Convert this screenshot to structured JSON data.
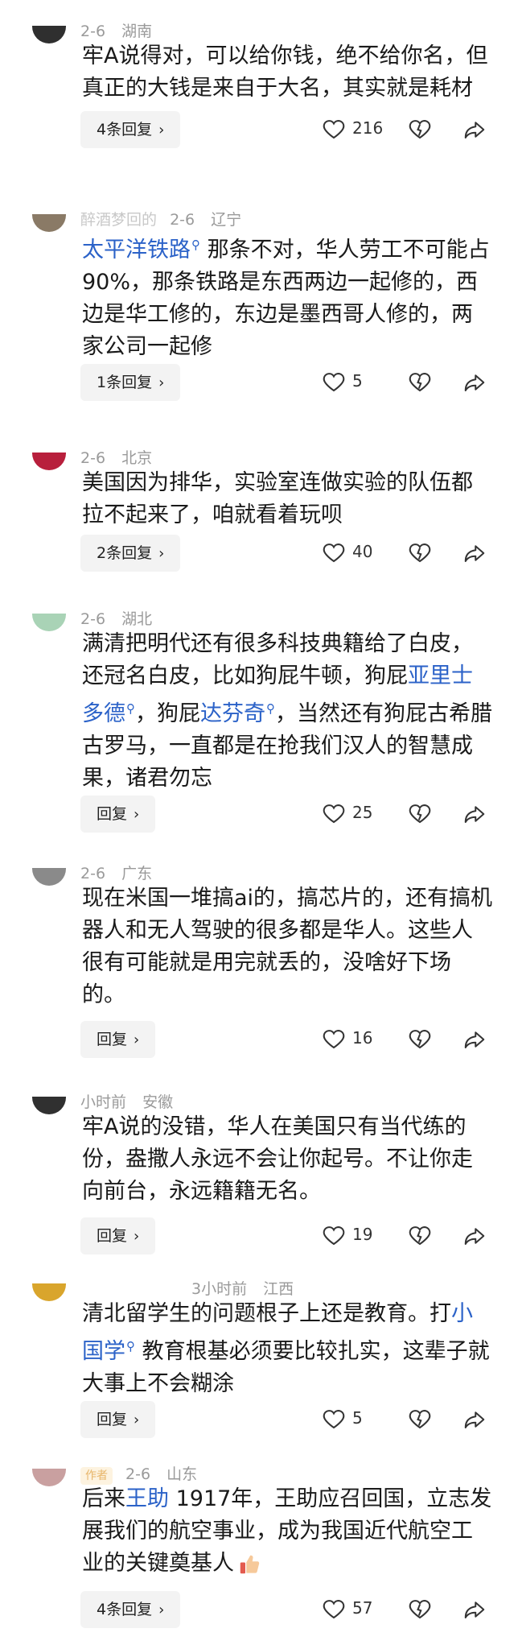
{
  "comments": [
    {
      "meta": {
        "name": "",
        "time": "2-6",
        "location": "湖南"
      },
      "text": "牢A说得对，可以给你钱，绝不给你名，但真正的大钱是来自于大名，其实就是耗材",
      "reply_label": "4条回复",
      "likes": "216"
    },
    {
      "meta": {
        "name": "醉酒梦回的",
        "time": "2-6",
        "location": "辽宁"
      },
      "link": "太平洋铁路",
      "text": "那条不对，华人劳工不可能占90%，那条铁路是东西两边一起修的，西边是华工修的，东边是墨西哥人修的，两家公司一起修",
      "reply_label": "1条回复",
      "likes": "5"
    },
    {
      "meta": {
        "name": "",
        "time": "2-6",
        "location": "北京"
      },
      "text": "美国因为排华，实验室连做实验的队伍都拉不起来了，咱就看着玩呗",
      "reply_label": "2条回复",
      "likes": "40"
    },
    {
      "meta": {
        "name": "",
        "time": "2-6",
        "location": "湖北"
      },
      "text_a": "满清把明代还有很多科技典籍给了白皮，还冠名白皮，比如狗屁牛顿，狗屁",
      "link_a": "亚里士多德",
      "text_b": "，狗屁",
      "link_b": "达芬奇",
      "text_c": "，当然还有狗屁古希腊古罗马，一直都是在抢我们汉人的智慧成果，诸君勿忘",
      "reply_label": "回复",
      "likes": "25"
    },
    {
      "meta": {
        "name": "",
        "time": "2-6",
        "location": "广东"
      },
      "text": "现在米国一堆搞ai的，搞芯片的，还有搞机器人和无人驾驶的很多都是华人。这些人很有可能就是用完就丢的，没啥好下场的。",
      "reply_label": "回复",
      "likes": "16"
    },
    {
      "meta": {
        "name": "",
        "time": "小时前",
        "location": "安徽"
      },
      "text": "牢A说的没错，华人在美国只有当代练的份，盎撒人永远不会让你起号。不让你走向前台，永远籍籍无名。",
      "reply_label": "回复",
      "likes": "19"
    },
    {
      "meta": {
        "name": "",
        "time": "3小时前",
        "location": "江西"
      },
      "text_a": "清北留学生的问题根子上还是教育。打",
      "link": "小国学",
      "text_b": "教育根基必须要比较扎实，这辈子就大事上不会糊涂",
      "reply_label": "回复",
      "likes": "5"
    },
    {
      "meta": {
        "name": "",
        "badge": "作者",
        "time": "2-6",
        "location": "山东"
      },
      "text_a": "后来",
      "link": "王助",
      "text_b": "1917年，王助应召回国，立志发展我们的航空事业，成为我国近代航空工业的关键奠基人",
      "reply_label": "4条回复",
      "likes": "57"
    }
  ],
  "icons": {
    "like": "heart-icon",
    "dislike": "broken-heart-icon",
    "share": "share-arrow-icon",
    "search": "search-icon",
    "reply_chevron": "chevron-right-icon"
  },
  "colors": {
    "link": "#2b62c8",
    "meta": "#9a9a9a",
    "reply_bg": "#f3f3f3"
  }
}
